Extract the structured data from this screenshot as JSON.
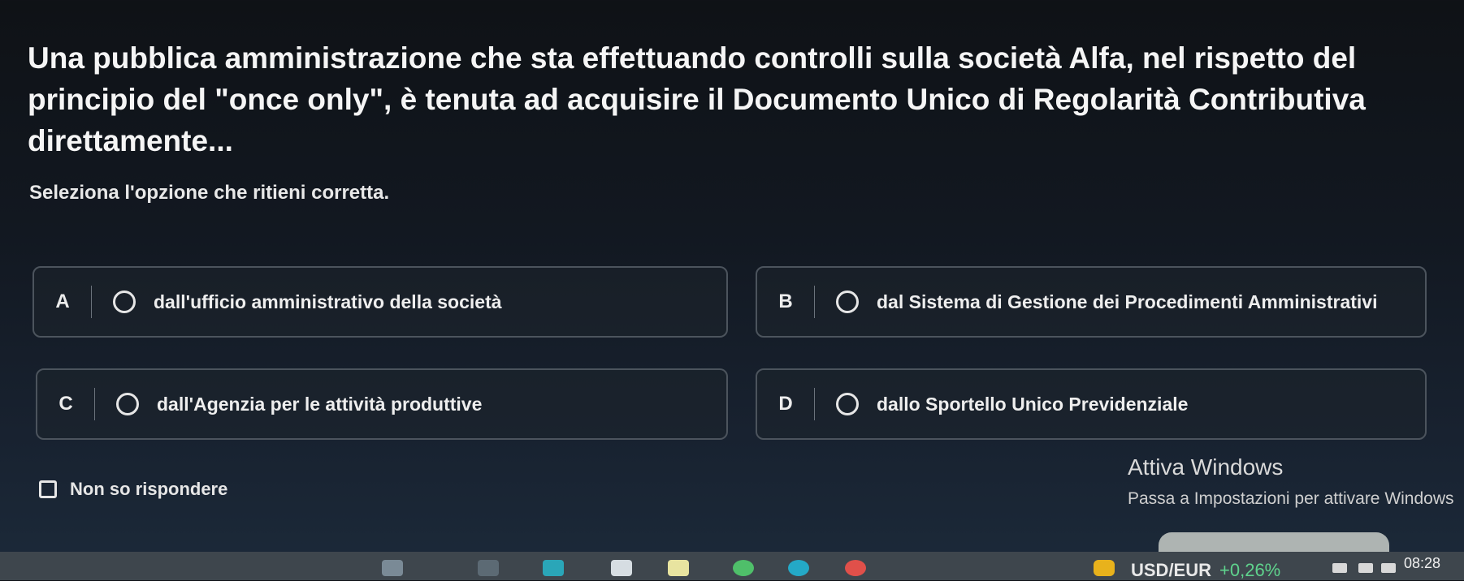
{
  "question": {
    "text": "Una pubblica amministrazione che sta effettuando controlli sulla società Alfa, nel rispetto del principio del \"once only\", è tenuta ad acquisire il Documento Unico di Regolarità Contributiva direttamente..."
  },
  "instruction": "Seleziona l'opzione che ritieni corretta.",
  "options": [
    {
      "letter": "A",
      "text": "dall'ufficio amministrativo della società"
    },
    {
      "letter": "B",
      "text": "dal Sistema di Gestione dei Procedimenti Amministrativi"
    },
    {
      "letter": "C",
      "text": "dall'Agenzia per le attività produttive"
    },
    {
      "letter": "D",
      "text": "dallo Sportello Unico Previdenziale"
    }
  ],
  "no_answer": {
    "label": "Non so rispondere"
  },
  "watermark": {
    "title": "Attiva Windows",
    "subtitle": "Passa a Impostazioni per attivare Windows"
  },
  "taskbar": {
    "ticker_symbol": "USD/EUR",
    "ticker_change": "+0,26%",
    "clock": "08:28",
    "icons": [
      "app-icon",
      "file-explorer-icon",
      "store-icon",
      "edge-icon",
      "chrome-icon",
      "office-icon",
      "mail-icon",
      "teams-icon"
    ],
    "colors": {
      "background": "#3e464d",
      "accent_green": "#5fd38d"
    }
  }
}
